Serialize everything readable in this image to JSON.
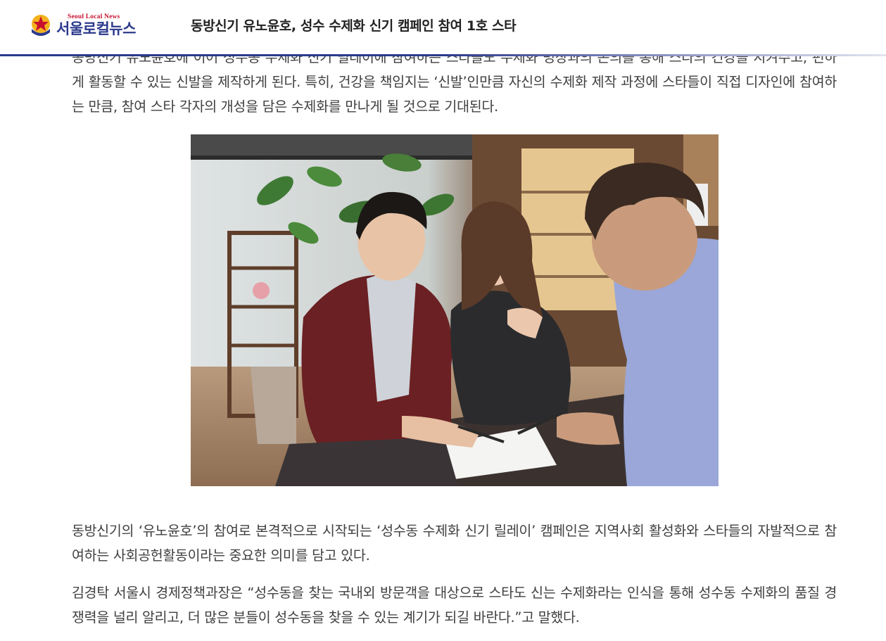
{
  "header": {
    "logo_en": "Seoul Local News",
    "logo_ko": "서울로컬뉴스",
    "title": "동방신기 유노윤호, 성수 수제화 신기 캠페인 참여 1호 스타"
  },
  "article": {
    "paragraph_top_clipped": "동방신기 유노윤호에 이어 성수동 수제화 신기 릴레이에 참여하는 스타들도 수제화 명장과의 논의를 통해 스타의 건강을 지켜주고, 편하게 활동할 수 있는 신발을 제작하게 된다. 특히, 건강을 책임지는 ‘신발’인만큼 자신의 수제화 제작 과정에 스타들이 직접 디자인에 참여하는 만큼, 참여 스타 각자의 개성을 담은 수제화를 만나게 될 것으로 기대된다.",
    "paragraph_2": "동방신기의 ‘유노윤호’의 참여로 본격적으로 시작되는 ‘성수동 수제화 신기 릴레이’ 캠페인은 지역사회 활성화와 스타들의 자발적으로 참여하는 사회공헌활동이라는 중요한 의미를 담고 있다.",
    "paragraph_3": "김경탁 서울시 경제정책과장은 “성수동을 찾는 국내외 방문객을 대상으로 스타도 신는 수제화라는 인식을 통해 성수동 수제화의 품질 경쟁력을 널리 알리고, 더 많은 분들이 성수동을 찾을 수 있는 계기가 되길 바란다.”고 말했다."
  },
  "colors": {
    "brand_navy": "#2c3a8c",
    "brand_red": "#c8102e",
    "text": "#404040"
  }
}
